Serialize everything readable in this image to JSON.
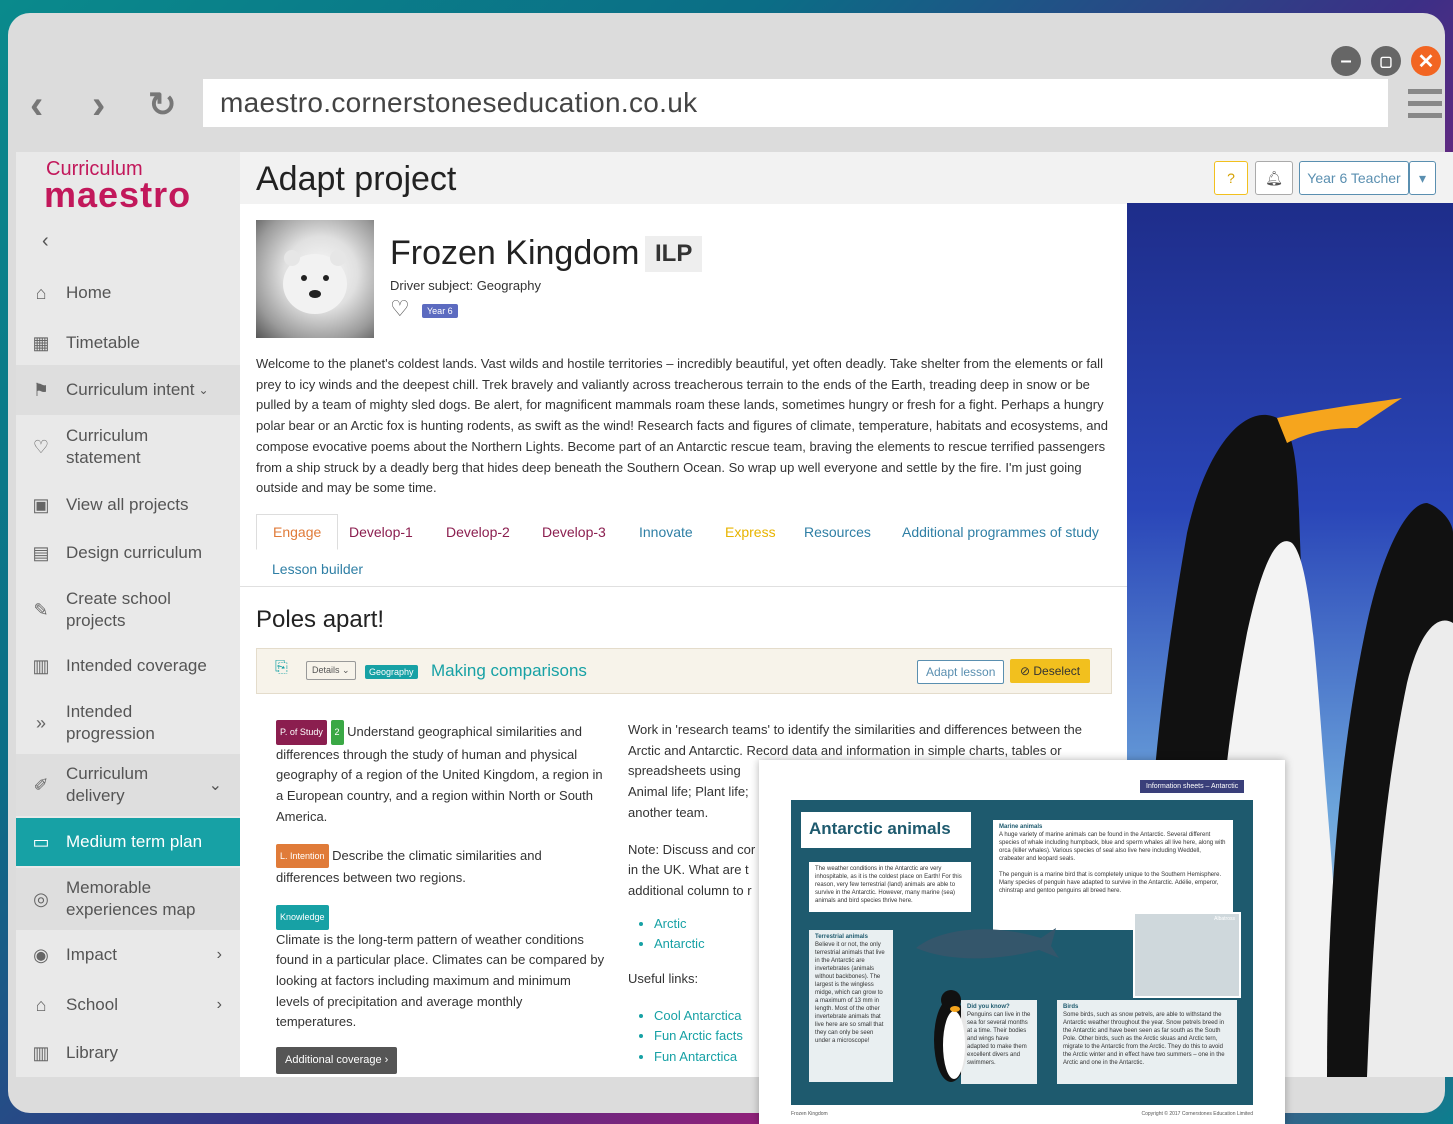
{
  "browser": {
    "url": "maestro.cornerstoneseducation.co.uk",
    "window_colors": {
      "minimize": "#666666",
      "maximize": "#666666",
      "close": "#f26522"
    }
  },
  "sidebar": {
    "logo_top": "Curriculum",
    "logo_main": "maestro",
    "items": [
      {
        "label": "Home",
        "icon": "home-icon"
      },
      {
        "label": "Timetable",
        "icon": "calendar-icon"
      },
      {
        "label": "Curriculum intent",
        "icon": "signpost-icon"
      },
      {
        "label": "Curriculum statement",
        "icon": "heart-icon"
      },
      {
        "label": "View all projects",
        "icon": "images-icon"
      },
      {
        "label": "Design curriculum",
        "icon": "document-icon"
      },
      {
        "label": "Create school projects",
        "icon": "edit-icon"
      },
      {
        "label": "Intended coverage",
        "icon": "clipboard-icon"
      },
      {
        "label": "Intended progression",
        "icon": "double-chevron-icon"
      },
      {
        "label": "Curriculum delivery",
        "icon": "pencil-icon"
      },
      {
        "label": "Medium term plan",
        "icon": "folder-icon"
      },
      {
        "label": "Memorable experiences map",
        "icon": "compass-icon"
      },
      {
        "label": "Impact",
        "icon": "target-icon"
      },
      {
        "label": "School",
        "icon": "school-icon"
      },
      {
        "label": "Library",
        "icon": "library-icon"
      }
    ]
  },
  "header": {
    "title": "Adapt project",
    "help_label": "?",
    "user_label": "Year 6 Teacher"
  },
  "project": {
    "title": "Frozen Kingdom",
    "badge": "ILP",
    "driver": "Driver subject: Geography",
    "year_tag": "Year 6",
    "description": "Welcome to the planet's coldest lands. Vast wilds and hostile territories – incredibly beautiful, yet often deadly. Take shelter from the elements or fall prey to icy winds and the deepest chill. Trek bravely and valiantly across treacherous terrain to the ends of the Earth, treading deep in snow or be pulled by a team of mighty sled dogs. Be alert, for magnificent mammals roam these lands, sometimes hungry or fresh for a fight. Perhaps a hungry polar bear or an Arctic fox is hunting rodents, as swift as the wind! Research facts and figures of climate, temperature, habitats and ecosystems, and compose evocative poems about the Northern Lights. Become part of an Antarctic rescue team, braving the elements to rescue terrified passengers from a ship struck by a deadly berg that hides deep beneath the Southern Ocean. So wrap up well everyone and settle by the fire. I'm just going outside and may be some time."
  },
  "tabs": [
    {
      "label": "Engage",
      "color": "#e07b39"
    },
    {
      "label": "Develop-1",
      "color": "#8b1e4f"
    },
    {
      "label": "Develop-2",
      "color": "#8b1e4f"
    },
    {
      "label": "Develop-3",
      "color": "#8b1e4f"
    },
    {
      "label": "Innovate",
      "color": "#2f7fa5"
    },
    {
      "label": "Express",
      "color": "#e8b400"
    },
    {
      "label": "Resources",
      "color": "#2f7fa5"
    },
    {
      "label": "Additional programmes of study",
      "color": "#2f7fa5"
    },
    {
      "label": "Lesson builder",
      "color": "#2f7fa5"
    }
  ],
  "section": {
    "title": "Poles apart!",
    "lesson": {
      "details_label": "Details",
      "subject_tag": "Geography",
      "title": "Making comparisons",
      "adapt_label": "Adapt lesson",
      "deselect_label": "Deselect"
    },
    "pos_tag": "P. of Study",
    "pos_num": "2",
    "pos_text": "Understand geographical similarities and differences through the study of human and physical geography of a region of the United Kingdom, a region in a European country, and a region within North or South America.",
    "intention_tag": "L. Intention",
    "intention_text": "Describe the climatic similarities and differences between two regions.",
    "knowledge_tag": "Knowledge",
    "knowledge_text": "Climate is the long-term pattern of weather conditions found in a particular place. Climates can be compared by looking at factors including maximum and minimum levels of precipitation and average monthly temperatures.",
    "additional_label": "Additional coverage",
    "activity_text": "Work in 'research teams' to identify the similarities and differences between the Arctic and Antarctic. Record data and information in simple charts, tables or spreadsheets using",
    "activity_text2": "Animal life; Plant life;",
    "activity_text3": "another team.",
    "note_text": "Note: Discuss and cor",
    "note_text2": "in the UK. What are t",
    "note_text3": "additional column to r",
    "links1": [
      "Arctic",
      "Antarctic"
    ],
    "useful_links_label": "Useful links:",
    "links2": [
      "Cool Antarctica",
      "Fun Arctic facts",
      "Fun Antarctica"
    ]
  },
  "info_sheet": {
    "header": "Information sheets – Antarctic",
    "title": "Antarctic animals",
    "intro": "The weather conditions in the Antarctic are very inhospitable, as it is the coldest place on Earth! For this reason, very few terrestrial (land) animals are able to survive in the Antarctic. However, many marine (sea) animals and bird species thrive here.",
    "marine_title": "Marine animals",
    "marine_text": "A huge variety of marine animals can be found in the Antarctic. Several different species of whale including humpback, blue and sperm whales all live here, along with orca (killer whales). Various species of seal also live here including Weddell, crabeater and leopard seals.",
    "penguin_text": "The penguin is a marine bird that is completely unique to the Southern Hemisphere. Many species of penguin have adapted to survive in the Antarctic. Adélie, emperor, chinstrap and gentoo penguins all breed here.",
    "terrestrial_title": "Terrestrial animals",
    "terrestrial_text": "Believe it or not, the only terrestrial animals that live in the Antarctic are invertebrates (animals without backbones). The largest is the wingless midge, which can grow to a maximum of 13 mm in length. Most of the other invertebrate animals that live here are so small that they can only be seen under a microscope!",
    "dyk_title": "Did you know?",
    "dyk_text": "Penguins can live in the sea for several months at a time. Their bodies and wings have adapted to make them excellent divers and swimmers.",
    "birds_title": "Birds",
    "birds_text": "Some birds, such as snow petrels, are able to withstand the Antarctic weather throughout the year. Snow petrels breed in the Antarctic and have been seen as far south as the South Pole. Other birds, such as the Arctic skuas and Arctic tern, migrate to the Antarctic from the Arctic. They do this to avoid the Arctic winter and in effect have two summers – one in the Arctic and one in the Antarctic.",
    "albatross_label": "Albatross",
    "footer_left": "Frozen Kingdom",
    "footer_right": "Copyright © 2017 Cornerstones Education Limited"
  }
}
